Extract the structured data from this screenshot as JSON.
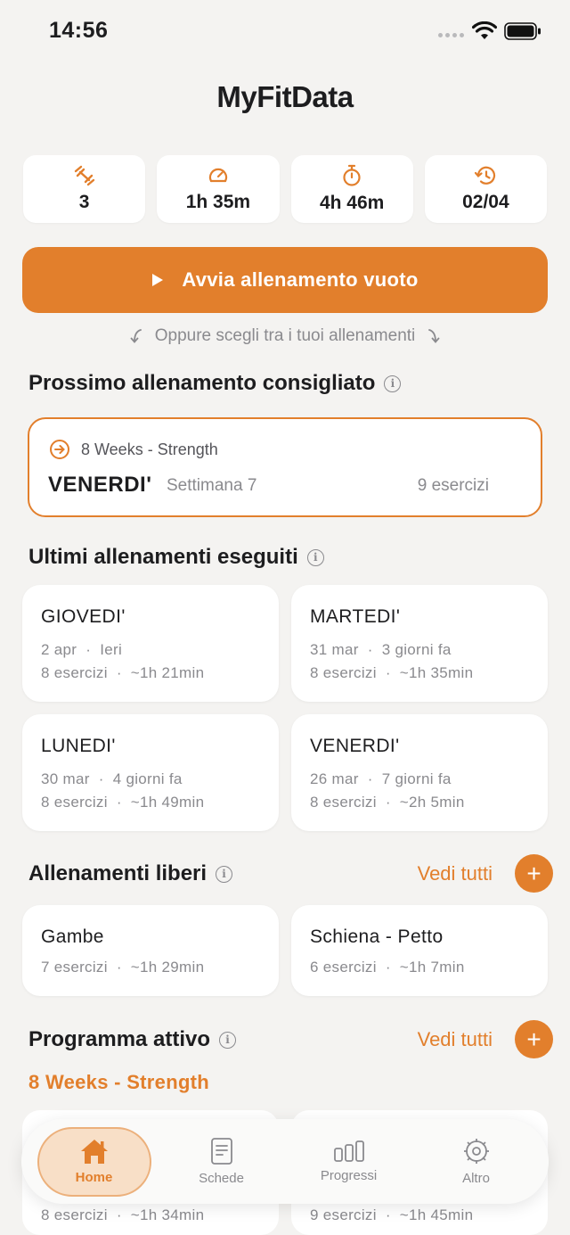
{
  "status_bar": {
    "time": "14:56"
  },
  "header": {
    "title": "MyFitData"
  },
  "stats": [
    {
      "icon": "dumbbell-icon",
      "value": "3"
    },
    {
      "icon": "speedometer-icon",
      "value": "1h 35m"
    },
    {
      "icon": "stopwatch-icon",
      "value": "4h 46m"
    },
    {
      "icon": "history-icon",
      "value": "02/04"
    }
  ],
  "start_button": {
    "label": "Avvia allenamento vuoto"
  },
  "hint": {
    "text": "Oppure scegli tra i tuoi allenamenti"
  },
  "next_workout": {
    "section_title": "Prossimo allenamento consigliato",
    "program": "8 Weeks - Strength",
    "day": "VENERDI'",
    "week": "Settimana 7",
    "exercises": "9 esercizi"
  },
  "recent": {
    "section_title": "Ultimi allenamenti eseguiti",
    "items": [
      {
        "title": "GIOVEDI'",
        "date": "2 apr",
        "ago": "Ieri",
        "exercises": "8 esercizi",
        "duration": "~1h 21min"
      },
      {
        "title": "MARTEDI'",
        "date": "31 mar",
        "ago": "3 giorni fa",
        "exercises": "8 esercizi",
        "duration": "~1h 35min"
      },
      {
        "title": "LUNEDI'",
        "date": "30 mar",
        "ago": "4 giorni fa",
        "exercises": "8 esercizi",
        "duration": "~1h 49min"
      },
      {
        "title": "VENERDI'",
        "date": "26 mar",
        "ago": "7 giorni fa",
        "exercises": "8 esercizi",
        "duration": "~2h 5min"
      }
    ]
  },
  "free_workouts": {
    "section_title": "Allenamenti liberi",
    "see_all": "Vedi tutti",
    "plus": "+",
    "items": [
      {
        "title": "Gambe",
        "exercises": "7 esercizi",
        "duration": "~1h 29min"
      },
      {
        "title": "Schiena - Petto",
        "exercises": "6 esercizi",
        "duration": "~1h 7min"
      }
    ]
  },
  "active_program": {
    "section_title": "Programma attivo",
    "see_all": "Vedi tutti",
    "plus": "+",
    "name": "8 Weeks - Strength",
    "items": [
      {
        "exercises": "8 esercizi",
        "duration": "~1h 34min"
      },
      {
        "exercises": "9 esercizi",
        "duration": "~1h 45min"
      }
    ]
  },
  "separator": "·",
  "tabs": [
    {
      "label": "Home",
      "icon": "home-icon",
      "active": true
    },
    {
      "label": "Schede",
      "icon": "document-icon",
      "active": false
    },
    {
      "label": "Progressi",
      "icon": "bar-chart-icon",
      "active": false
    },
    {
      "label": "Altro",
      "icon": "gear-icon",
      "active": false
    }
  ],
  "colors": {
    "accent": "#e27f2c",
    "background": "#f4f3f1",
    "card": "#ffffff",
    "muted": "#8a8a8e"
  }
}
